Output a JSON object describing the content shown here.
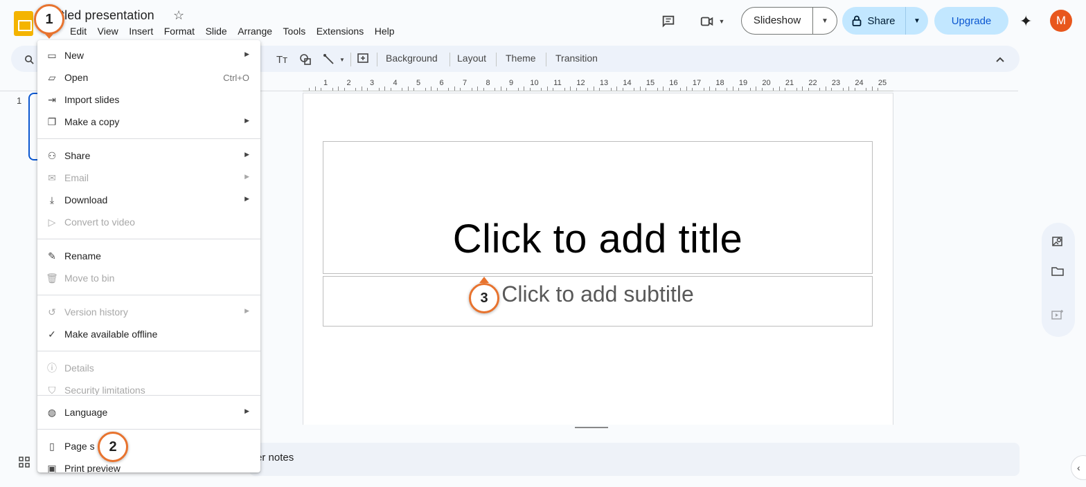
{
  "app": {
    "doc_title": "tled presentation",
    "menus": [
      "Edit",
      "View",
      "Insert",
      "Format",
      "Slide",
      "Arrange",
      "Tools",
      "Extensions",
      "Help"
    ]
  },
  "header": {
    "slideshow_label": "Slideshow",
    "share_label": "Share",
    "upgrade_label": "Upgrade",
    "avatar_initial": "M"
  },
  "toolbar": {
    "background": "Background",
    "layout": "Layout",
    "theme": "Theme",
    "transition": "Transition"
  },
  "ruler": {
    "numbers": [
      "1",
      "2",
      "3",
      "4",
      "5",
      "6",
      "7",
      "8",
      "9",
      "10",
      "11",
      "12",
      "13",
      "14",
      "15",
      "16",
      "17",
      "18",
      "19",
      "20",
      "21",
      "22",
      "23",
      "24",
      "25"
    ]
  },
  "slide_panel": {
    "slide_number": "1"
  },
  "slide": {
    "title_placeholder": "Click to add title",
    "subtitle_placeholder": "Click to add subtitle"
  },
  "notes": {
    "placeholder_visible": "er notes"
  },
  "file_menu": {
    "items": [
      {
        "label": "New",
        "icon": "new-presentation-icon",
        "submenu": true,
        "disabled": false
      },
      {
        "label": "Open",
        "icon": "folder-open-icon",
        "shortcut": "Ctrl+O",
        "disabled": false
      },
      {
        "label": "Import slides",
        "icon": "import-icon",
        "disabled": false
      },
      {
        "label": "Make a copy",
        "icon": "copy-icon",
        "submenu": true,
        "disabled": false
      },
      {
        "label": "Share",
        "icon": "person-add-icon",
        "submenu": true,
        "disabled": false
      },
      {
        "label": "Email",
        "icon": "mail-icon",
        "submenu": true,
        "disabled": true
      },
      {
        "label": "Download",
        "icon": "download-icon",
        "submenu": true,
        "disabled": false
      },
      {
        "label": "Convert to video",
        "icon": "video-convert-icon",
        "disabled": true
      },
      {
        "label": "Rename",
        "icon": "pencil-icon",
        "disabled": false
      },
      {
        "label": "Move to bin",
        "icon": "trash-icon",
        "disabled": true
      },
      {
        "label": "Version history",
        "icon": "history-icon",
        "submenu": true,
        "disabled": true
      },
      {
        "label": "Make available offline",
        "icon": "offline-check-icon",
        "disabled": false
      },
      {
        "label": "Details",
        "icon": "info-icon",
        "disabled": true
      },
      {
        "label": "Security limitations",
        "icon": "shield-icon",
        "disabled": true
      },
      {
        "label": "Language",
        "icon": "globe-icon",
        "submenu": true,
        "disabled": false
      },
      {
        "label": "Page s",
        "icon": "page-icon",
        "disabled": false
      },
      {
        "label": "Print preview",
        "icon": "print-preview-icon",
        "disabled": false
      }
    ]
  },
  "annotations": {
    "badge1": "1",
    "badge2": "2",
    "badge3": "3",
    "color": "#e8732e"
  }
}
